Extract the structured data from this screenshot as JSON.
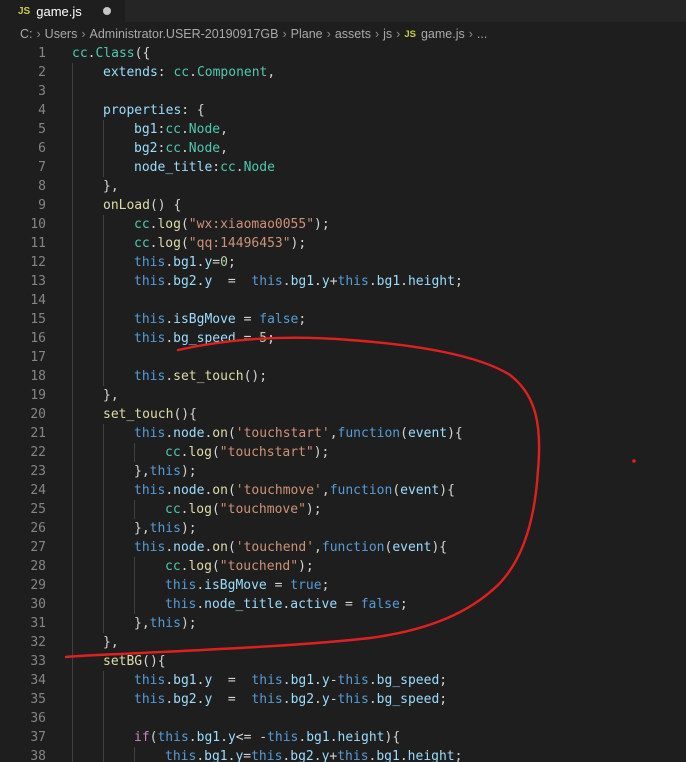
{
  "tab": {
    "label": "game.js",
    "badge": "JS"
  },
  "breadcrumb": [
    {
      "text": "C:"
    },
    {
      "text": "Users"
    },
    {
      "text": "Administrator.USER-20190917GB"
    },
    {
      "text": "Plane"
    },
    {
      "text": "assets"
    },
    {
      "text": "js"
    },
    {
      "text": "game.js",
      "badge": "JS"
    },
    {
      "text": "..."
    }
  ],
  "lines": [
    {
      "n": "1",
      "indent": 0,
      "tokens": [
        [
          "cls",
          "cc"
        ],
        [
          "pun",
          "."
        ],
        [
          "cls",
          "Class"
        ],
        [
          "pun",
          "({"
        ]
      ]
    },
    {
      "n": "2",
      "indent": 1,
      "tokens": [
        [
          "prop",
          "extends"
        ],
        [
          "pun",
          ": "
        ],
        [
          "cls",
          "cc"
        ],
        [
          "pun",
          "."
        ],
        [
          "cls",
          "Component"
        ],
        [
          "pun",
          ","
        ]
      ]
    },
    {
      "n": "3",
      "indent": 1,
      "tokens": []
    },
    {
      "n": "4",
      "indent": 1,
      "tokens": [
        [
          "prop",
          "properties"
        ],
        [
          "pun",
          ": {"
        ]
      ]
    },
    {
      "n": "5",
      "indent": 2,
      "tokens": [
        [
          "prop",
          "bg1"
        ],
        [
          "pun",
          ":"
        ],
        [
          "cls",
          "cc"
        ],
        [
          "pun",
          "."
        ],
        [
          "cls",
          "Node"
        ],
        [
          "pun",
          ","
        ]
      ]
    },
    {
      "n": "6",
      "indent": 2,
      "tokens": [
        [
          "prop",
          "bg2"
        ],
        [
          "pun",
          ":"
        ],
        [
          "cls",
          "cc"
        ],
        [
          "pun",
          "."
        ],
        [
          "cls",
          "Node"
        ],
        [
          "pun",
          ","
        ]
      ]
    },
    {
      "n": "7",
      "indent": 2,
      "tokens": [
        [
          "prop",
          "node_title"
        ],
        [
          "pun",
          ":"
        ],
        [
          "cls",
          "cc"
        ],
        [
          "pun",
          "."
        ],
        [
          "cls",
          "Node"
        ]
      ]
    },
    {
      "n": "8",
      "indent": 1,
      "tokens": [
        [
          "pun",
          "},"
        ]
      ]
    },
    {
      "n": "9",
      "indent": 1,
      "tokens": [
        [
          "fn",
          "onLoad"
        ],
        [
          "pun",
          "() {"
        ]
      ]
    },
    {
      "n": "10",
      "indent": 2,
      "tokens": [
        [
          "cls",
          "cc"
        ],
        [
          "pun",
          "."
        ],
        [
          "fn",
          "log"
        ],
        [
          "pun",
          "("
        ],
        [
          "str",
          "\"wx:xiaomao0055\""
        ],
        [
          "pun",
          ");"
        ]
      ]
    },
    {
      "n": "11",
      "indent": 2,
      "tokens": [
        [
          "cls",
          "cc"
        ],
        [
          "pun",
          "."
        ],
        [
          "fn",
          "log"
        ],
        [
          "pun",
          "("
        ],
        [
          "str",
          "\"qq:14496453\""
        ],
        [
          "pun",
          ");"
        ]
      ]
    },
    {
      "n": "12",
      "indent": 2,
      "tokens": [
        [
          "kw",
          "this"
        ],
        [
          "pun",
          "."
        ],
        [
          "prop",
          "bg1"
        ],
        [
          "pun",
          "."
        ],
        [
          "prop",
          "y"
        ],
        [
          "pun",
          "="
        ],
        [
          "num",
          "0"
        ],
        [
          "pun",
          ";"
        ]
      ]
    },
    {
      "n": "13",
      "indent": 2,
      "tokens": [
        [
          "kw",
          "this"
        ],
        [
          "pun",
          "."
        ],
        [
          "prop",
          "bg2"
        ],
        [
          "pun",
          "."
        ],
        [
          "prop",
          "y"
        ],
        [
          "pun",
          "  =  "
        ],
        [
          "kw",
          "this"
        ],
        [
          "pun",
          "."
        ],
        [
          "prop",
          "bg1"
        ],
        [
          "pun",
          "."
        ],
        [
          "prop",
          "y"
        ],
        [
          "pun",
          "+"
        ],
        [
          "kw",
          "this"
        ],
        [
          "pun",
          "."
        ],
        [
          "prop",
          "bg1"
        ],
        [
          "pun",
          "."
        ],
        [
          "prop",
          "height"
        ],
        [
          "pun",
          ";"
        ]
      ]
    },
    {
      "n": "14",
      "indent": 2,
      "tokens": []
    },
    {
      "n": "15",
      "indent": 2,
      "tokens": [
        [
          "kw",
          "this"
        ],
        [
          "pun",
          "."
        ],
        [
          "prop",
          "isBgMove"
        ],
        [
          "pun",
          " = "
        ],
        [
          "kw",
          "false"
        ],
        [
          "pun",
          ";"
        ]
      ]
    },
    {
      "n": "16",
      "indent": 2,
      "tokens": [
        [
          "kw",
          "this"
        ],
        [
          "pun",
          "."
        ],
        [
          "prop",
          "bg_speed"
        ],
        [
          "pun",
          " = "
        ],
        [
          "num",
          "5"
        ],
        [
          "pun",
          ";"
        ]
      ]
    },
    {
      "n": "17",
      "indent": 2,
      "tokens": []
    },
    {
      "n": "18",
      "indent": 2,
      "tokens": [
        [
          "kw",
          "this"
        ],
        [
          "pun",
          "."
        ],
        [
          "fn",
          "set_touch"
        ],
        [
          "pun",
          "();"
        ]
      ]
    },
    {
      "n": "19",
      "indent": 1,
      "tokens": [
        [
          "pun",
          "},"
        ]
      ]
    },
    {
      "n": "20",
      "indent": 1,
      "tokens": [
        [
          "fn",
          "set_touch"
        ],
        [
          "pun",
          "(){"
        ]
      ]
    },
    {
      "n": "21",
      "indent": 2,
      "tokens": [
        [
          "kw",
          "this"
        ],
        [
          "pun",
          "."
        ],
        [
          "prop",
          "node"
        ],
        [
          "pun",
          "."
        ],
        [
          "fn",
          "on"
        ],
        [
          "pun",
          "("
        ],
        [
          "str",
          "'touchstart'"
        ],
        [
          "pun",
          ","
        ],
        [
          "kw",
          "function"
        ],
        [
          "pun",
          "("
        ],
        [
          "prop",
          "event"
        ],
        [
          "pun",
          "){"
        ]
      ]
    },
    {
      "n": "22",
      "indent": 3,
      "tokens": [
        [
          "cls",
          "cc"
        ],
        [
          "pun",
          "."
        ],
        [
          "fn",
          "log"
        ],
        [
          "pun",
          "("
        ],
        [
          "str",
          "\"touchstart\""
        ],
        [
          "pun",
          ");"
        ]
      ]
    },
    {
      "n": "23",
      "indent": 2,
      "tokens": [
        [
          "pun",
          "},"
        ],
        [
          "kw",
          "this"
        ],
        [
          "pun",
          ");"
        ]
      ]
    },
    {
      "n": "24",
      "indent": 2,
      "tokens": [
        [
          "kw",
          "this"
        ],
        [
          "pun",
          "."
        ],
        [
          "prop",
          "node"
        ],
        [
          "pun",
          "."
        ],
        [
          "fn",
          "on"
        ],
        [
          "pun",
          "("
        ],
        [
          "str",
          "'touchmove'"
        ],
        [
          "pun",
          ","
        ],
        [
          "kw",
          "function"
        ],
        [
          "pun",
          "("
        ],
        [
          "prop",
          "event"
        ],
        [
          "pun",
          "){"
        ]
      ]
    },
    {
      "n": "25",
      "indent": 3,
      "tokens": [
        [
          "cls",
          "cc"
        ],
        [
          "pun",
          "."
        ],
        [
          "fn",
          "log"
        ],
        [
          "pun",
          "("
        ],
        [
          "str",
          "\"touchmove\""
        ],
        [
          "pun",
          ");"
        ]
      ]
    },
    {
      "n": "26",
      "indent": 2,
      "tokens": [
        [
          "pun",
          "},"
        ],
        [
          "kw",
          "this"
        ],
        [
          "pun",
          ");"
        ]
      ]
    },
    {
      "n": "27",
      "indent": 2,
      "tokens": [
        [
          "kw",
          "this"
        ],
        [
          "pun",
          "."
        ],
        [
          "prop",
          "node"
        ],
        [
          "pun",
          "."
        ],
        [
          "fn",
          "on"
        ],
        [
          "pun",
          "("
        ],
        [
          "str",
          "'touchend'"
        ],
        [
          "pun",
          ","
        ],
        [
          "kw",
          "function"
        ],
        [
          "pun",
          "("
        ],
        [
          "prop",
          "event"
        ],
        [
          "pun",
          "){"
        ]
      ]
    },
    {
      "n": "28",
      "indent": 3,
      "tokens": [
        [
          "cls",
          "cc"
        ],
        [
          "pun",
          "."
        ],
        [
          "fn",
          "log"
        ],
        [
          "pun",
          "("
        ],
        [
          "str",
          "\"touchend\""
        ],
        [
          "pun",
          ");"
        ]
      ]
    },
    {
      "n": "29",
      "indent": 3,
      "tokens": [
        [
          "kw",
          "this"
        ],
        [
          "pun",
          "."
        ],
        [
          "prop",
          "isBgMove"
        ],
        [
          "pun",
          " = "
        ],
        [
          "kw",
          "true"
        ],
        [
          "pun",
          ";"
        ]
      ]
    },
    {
      "n": "30",
      "indent": 3,
      "tokens": [
        [
          "kw",
          "this"
        ],
        [
          "pun",
          "."
        ],
        [
          "prop",
          "node_title"
        ],
        [
          "pun",
          "."
        ],
        [
          "prop",
          "active"
        ],
        [
          "pun",
          " = "
        ],
        [
          "kw",
          "false"
        ],
        [
          "pun",
          ";"
        ]
      ]
    },
    {
      "n": "31",
      "indent": 2,
      "tokens": [
        [
          "pun",
          "},"
        ],
        [
          "kw",
          "this"
        ],
        [
          "pun",
          ");"
        ]
      ]
    },
    {
      "n": "32",
      "indent": 1,
      "tokens": [
        [
          "pun",
          "},"
        ]
      ]
    },
    {
      "n": "33",
      "indent": 1,
      "tokens": [
        [
          "fn",
          "setBG"
        ],
        [
          "pun",
          "(){"
        ]
      ]
    },
    {
      "n": "34",
      "indent": 2,
      "tokens": [
        [
          "kw",
          "this"
        ],
        [
          "pun",
          "."
        ],
        [
          "prop",
          "bg1"
        ],
        [
          "pun",
          "."
        ],
        [
          "prop",
          "y"
        ],
        [
          "pun",
          "  =  "
        ],
        [
          "kw",
          "this"
        ],
        [
          "pun",
          "."
        ],
        [
          "prop",
          "bg1"
        ],
        [
          "pun",
          "."
        ],
        [
          "prop",
          "y"
        ],
        [
          "pun",
          "-"
        ],
        [
          "kw",
          "this"
        ],
        [
          "pun",
          "."
        ],
        [
          "prop",
          "bg_speed"
        ],
        [
          "pun",
          ";"
        ]
      ]
    },
    {
      "n": "35",
      "indent": 2,
      "tokens": [
        [
          "kw",
          "this"
        ],
        [
          "pun",
          "."
        ],
        [
          "prop",
          "bg2"
        ],
        [
          "pun",
          "."
        ],
        [
          "prop",
          "y"
        ],
        [
          "pun",
          "  =  "
        ],
        [
          "kw",
          "this"
        ],
        [
          "pun",
          "."
        ],
        [
          "prop",
          "bg2"
        ],
        [
          "pun",
          "."
        ],
        [
          "prop",
          "y"
        ],
        [
          "pun",
          "-"
        ],
        [
          "kw",
          "this"
        ],
        [
          "pun",
          "."
        ],
        [
          "prop",
          "bg_speed"
        ],
        [
          "pun",
          ";"
        ]
      ]
    },
    {
      "n": "36",
      "indent": 2,
      "tokens": []
    },
    {
      "n": "37",
      "indent": 2,
      "tokens": [
        [
          "ctl",
          "if"
        ],
        [
          "pun",
          "("
        ],
        [
          "kw",
          "this"
        ],
        [
          "pun",
          "."
        ],
        [
          "prop",
          "bg1"
        ],
        [
          "pun",
          "."
        ],
        [
          "prop",
          "y"
        ],
        [
          "pun",
          "<= -"
        ],
        [
          "kw",
          "this"
        ],
        [
          "pun",
          "."
        ],
        [
          "prop",
          "bg1"
        ],
        [
          "pun",
          "."
        ],
        [
          "prop",
          "height"
        ],
        [
          "pun",
          "){"
        ]
      ]
    },
    {
      "n": "38",
      "indent": 3,
      "tokens": [
        [
          "kw",
          "this"
        ],
        [
          "pun",
          "."
        ],
        [
          "prop",
          "bg1"
        ],
        [
          "pun",
          "."
        ],
        [
          "prop",
          "y"
        ],
        [
          "pun",
          "="
        ],
        [
          "kw",
          "this"
        ],
        [
          "pun",
          "."
        ],
        [
          "prop",
          "bg2"
        ],
        [
          "pun",
          "."
        ],
        [
          "prop",
          "y"
        ],
        [
          "pun",
          "+"
        ],
        [
          "kw",
          "this"
        ],
        [
          "pun",
          "."
        ],
        [
          "prop",
          "bg1"
        ],
        [
          "pun",
          "."
        ],
        [
          "prop",
          "height"
        ],
        [
          "pun",
          ";"
        ]
      ]
    }
  ],
  "colors": {
    "background": "#1e1e1e",
    "annotation": "#e02020"
  }
}
